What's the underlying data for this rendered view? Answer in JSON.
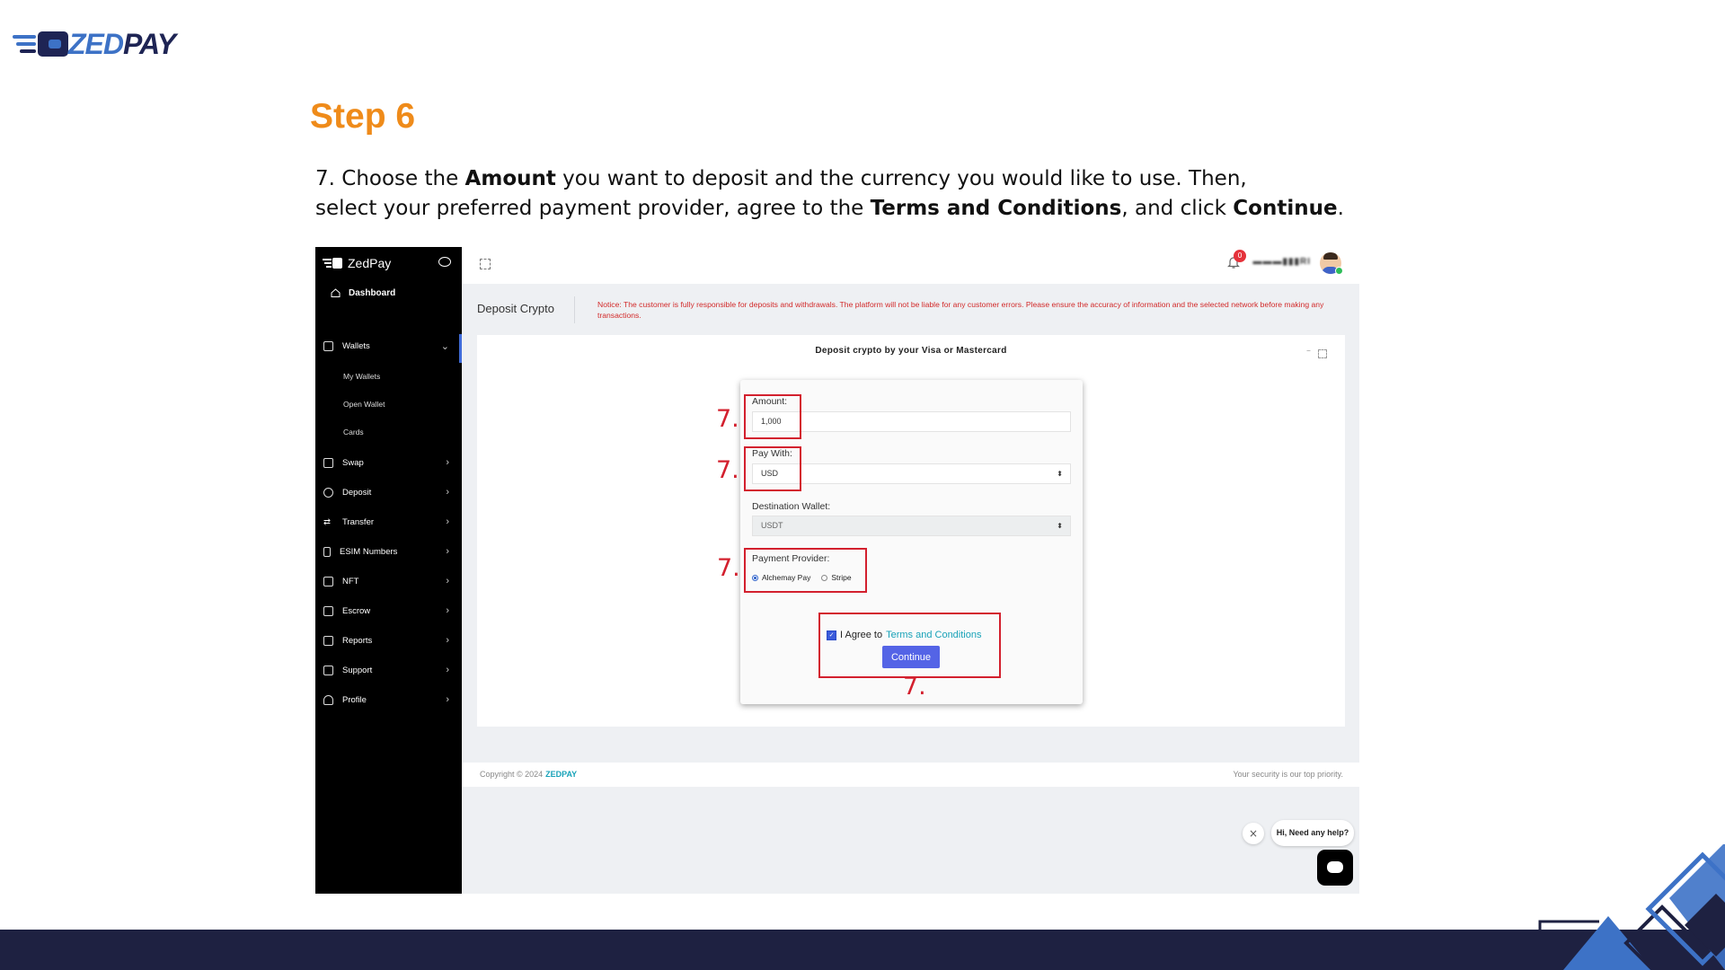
{
  "brand": {
    "logo_zed": "ZED",
    "logo_pay": "PAY"
  },
  "slide": {
    "title": "Step 6",
    "text_1": "7. Choose the ",
    "bold_1": "Amount",
    "text_2": " you want to deposit and the currency you would like to use. Then,",
    "text_3": "select your preferred payment provider, agree to the ",
    "bold_2": "Terms and Conditions",
    "text_4": ", and click ",
    "bold_3": "Continue",
    "text_5": "."
  },
  "app": {
    "name": "ZedPay",
    "dashboard": "Dashboard",
    "sidebar": {
      "wallets": "Wallets",
      "sub": [
        "My Wallets",
        "Open Wallet",
        "Cards"
      ],
      "items": [
        "Swap",
        "Deposit",
        "Transfer",
        "ESIM Numbers",
        "NFT",
        "Escrow",
        "Reports",
        "Support",
        "Profile"
      ]
    },
    "topbar": {
      "badge": "0",
      "username": "▬▬▬▮▮▮RI"
    },
    "page_title": "Deposit Crypto",
    "notice": "Notice: The customer is fully responsible for deposits and withdrawals. The platform will not be liable for any customer errors. Please ensure the accuracy of information and the selected network before making any transactions.",
    "card_title": "Deposit crypto by your Visa or Mastercard",
    "form": {
      "amount_label": "Amount:",
      "amount_value": "1,000",
      "pay_with_label": "Pay With:",
      "pay_with_value": "USD",
      "dest_label": "Destination Wallet:",
      "dest_value": "USDT",
      "provider_label": "Payment Provider:",
      "provider_options": [
        "Alchemay Pay",
        "Stripe"
      ],
      "provider_selected": "Alchemay Pay",
      "agree_text": "I Agree to",
      "terms_link": "Terms and Conditions",
      "continue": "Continue"
    },
    "footer": {
      "copyright": "Copyright © 2024",
      "brand": "ZEDPAY",
      "security": "Your security is our top priority."
    },
    "chat": {
      "bubble": "Hi, Need any help?",
      "close": "×"
    }
  },
  "annotations": {
    "step_label": "7."
  },
  "colors": {
    "accent_orange": "#ef8b1a",
    "navy": "#1e2141",
    "annotation_red": "#d3202e",
    "button_blue": "#5464e6"
  }
}
